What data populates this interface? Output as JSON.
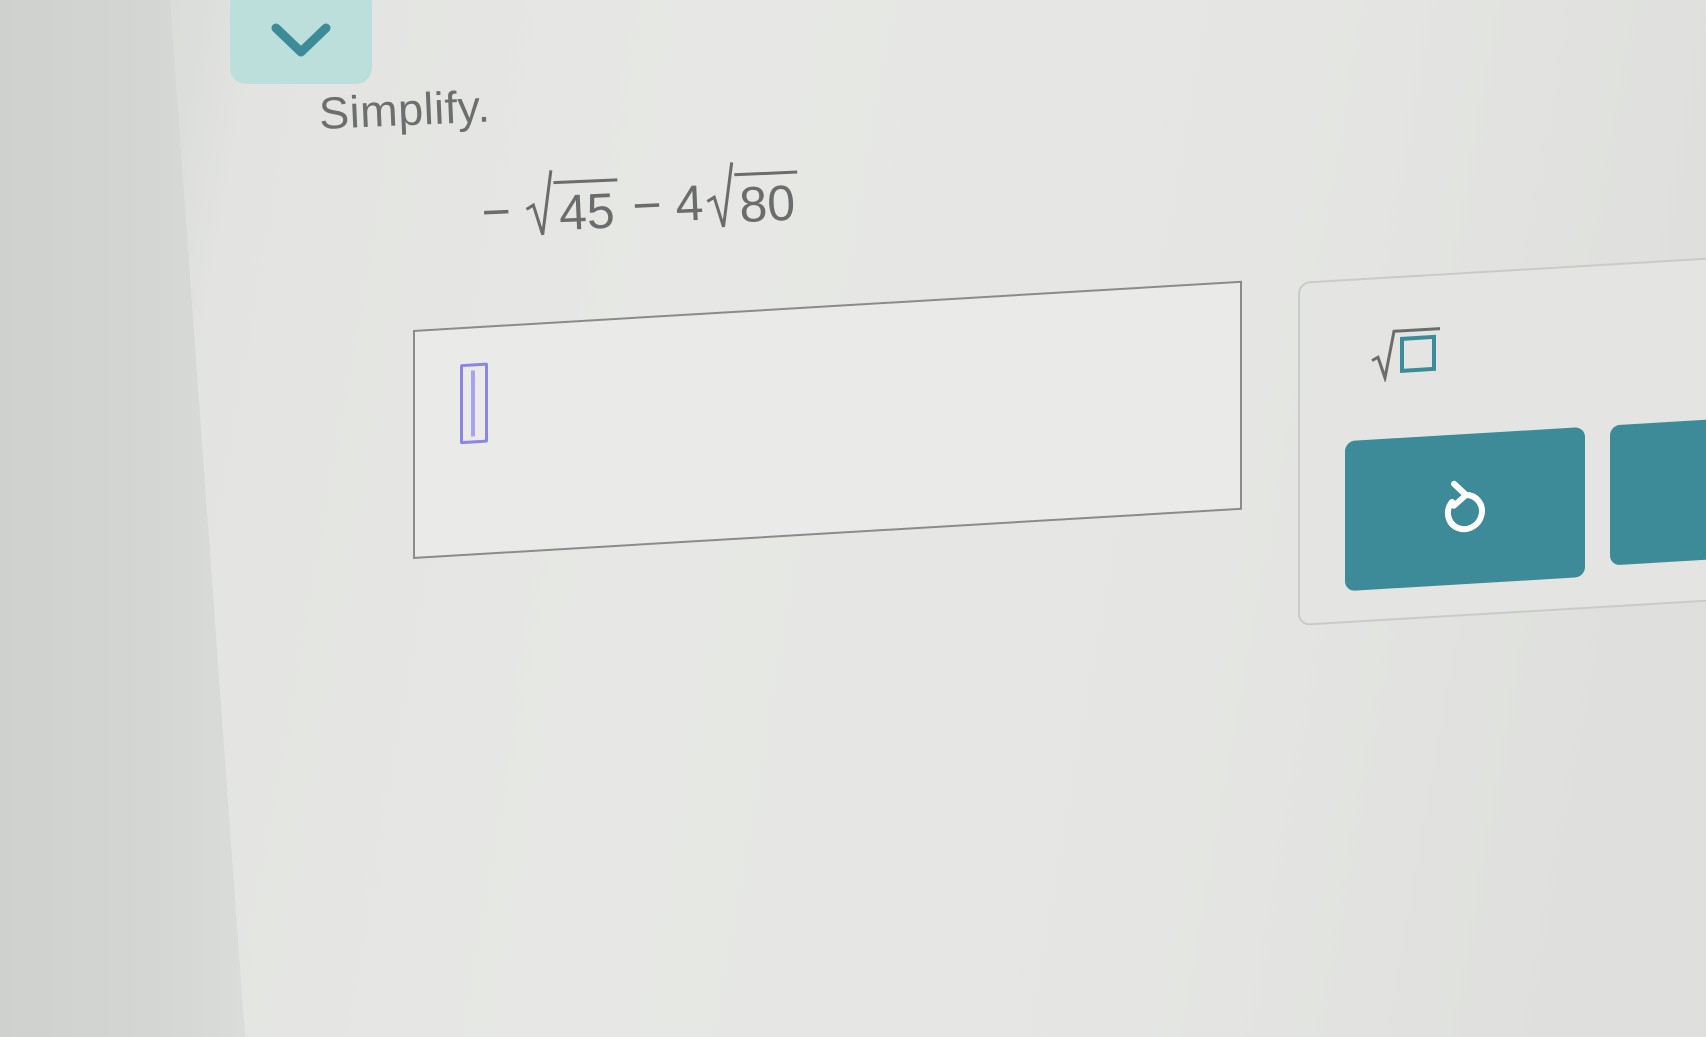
{
  "question": {
    "instruction": "Simplify.",
    "expression": {
      "leading_sign": "−",
      "term1_radicand": "45",
      "operator": "−",
      "term2_coefficient": "4",
      "term2_radicand": "80"
    }
  },
  "answer": {
    "value": ""
  },
  "keypad": {
    "keys": [
      {
        "name": "square-root",
        "icon": "sqrt-template-icon"
      },
      {
        "name": "undo",
        "icon": "undo-icon"
      },
      {
        "name": "more",
        "icon": "partially-visible"
      }
    ]
  },
  "colors": {
    "accent": "#3d8a98",
    "tab": "#bddfdb",
    "cursor": "#8a86e6",
    "text": "#6b6d6c"
  }
}
